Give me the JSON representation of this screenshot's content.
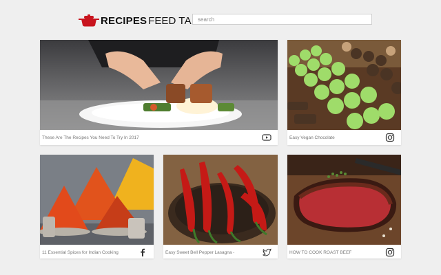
{
  "header": {
    "brand_bold": "RECIPES",
    "brand_feed": "FEED",
    "brand_tab": "TAB",
    "search_placeholder": "search"
  },
  "colors": {
    "accent_red": "#c8141e",
    "background": "#efefef",
    "caption": "#777777"
  },
  "cards": [
    {
      "caption": "These Are The Recipes You Need To Try In 2017",
      "source_icon": "youtube-icon",
      "image": "chef-plating-food-image"
    },
    {
      "caption": "Easy Vegan Chocolate",
      "source_icon": "instagram-icon",
      "image": "green-chocolate-truffles-image"
    },
    {
      "caption": "11 Essential Spices for Indian Cooking",
      "source_icon": "facebook-icon",
      "image": "spice-mounds-image"
    },
    {
      "caption": "Easy Sweet Bell Pepper Lasagna -",
      "source_icon": "twitter-icon",
      "image": "red-chili-peppers-image"
    },
    {
      "caption": "HOW TO COOK ROAST BEEF",
      "source_icon": "instagram-icon",
      "image": "roast-beef-image"
    }
  ]
}
